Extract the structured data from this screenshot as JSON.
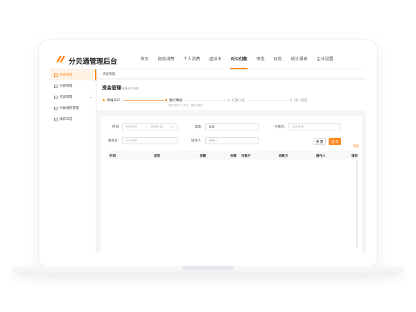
{
  "app": {
    "name": "分贝通管理后台"
  },
  "nav": {
    "items": [
      "首页",
      "商务消费",
      "个人消费",
      "虚拟卡",
      "对公付款",
      "审批",
      "财务",
      "统计报表",
      "企业设置"
    ],
    "active": "对公付款"
  },
  "sidebar": {
    "items": [
      {
        "label": "资金管理",
        "active": true
      },
      {
        "label": "付款管理"
      },
      {
        "label": "检索管理",
        "expandable": true
      },
      {
        "label": "付款授权管理"
      },
      {
        "label": "操作日志"
      }
    ]
  },
  "breadcrumb": {
    "text": "资金管理"
  },
  "page": {
    "title": "资金管理",
    "subtitle": "账服开户流程"
  },
  "steps": {
    "items": [
      {
        "label": "申请开户",
        "status": "done"
      },
      {
        "label": "银行审核",
        "status": "current",
        "note": "预计1至5个工作日，请耐心等待"
      },
      {
        "label": "打款认证",
        "status": "pending"
      },
      {
        "label": "开户完成",
        "status": "pending"
      }
    ]
  },
  "filters": {
    "time": {
      "label": "时间:",
      "start_placeholder": "开始时间",
      "separator": "~",
      "end_placeholder": "结束时间"
    },
    "type": {
      "label": "类型:",
      "value": "全部"
    },
    "payer": {
      "label": "付款方:",
      "placeholder": "公司名称"
    },
    "payee": {
      "label": "收款方:",
      "placeholder": "公司名称"
    },
    "operator": {
      "label": "操作人:",
      "placeholder": "请输入"
    },
    "reset_label": "重 置",
    "search_label": "查 询"
  },
  "export_label": "导出",
  "table": {
    "columns": [
      "时间",
      "类型",
      "金额",
      "余额",
      "付款方",
      "收款方",
      "操作人",
      "操作"
    ]
  },
  "colors": {
    "accent": "#ff8a1f"
  }
}
